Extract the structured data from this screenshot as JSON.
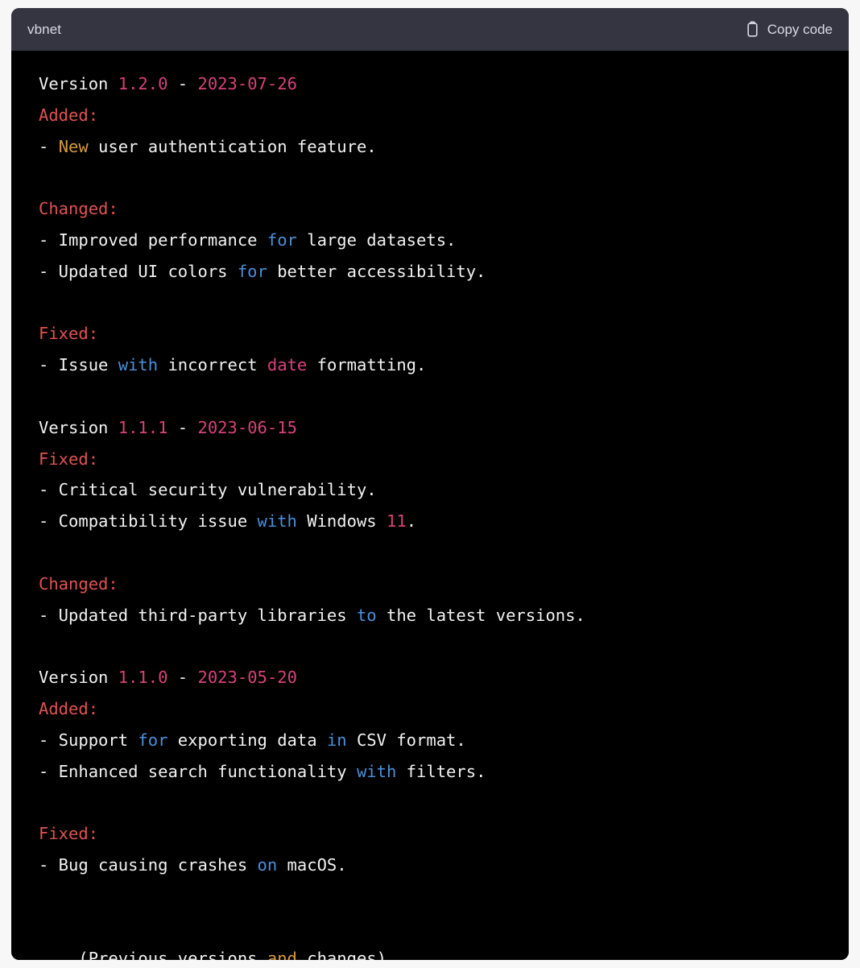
{
  "code_block": {
    "language_label": "vbnet",
    "copy_button": {
      "label": "Copy code",
      "icon": "clipboard-icon"
    },
    "colors": {
      "header_background": "#343541",
      "body_background": "#000000",
      "page_background": "#f7f7f8",
      "default_text": "#f2f2f2",
      "header_text": "#d9d9e3",
      "section_red": "#e05252",
      "number_pink": "#d6427a",
      "keyword_blue": "#4a90d9",
      "literal_orange": "#d79a3a"
    },
    "lines": [
      [
        {
          "t": "Version ",
          "c": "plain"
        },
        {
          "t": "1.2.0",
          "c": "number"
        },
        {
          "t": " - ",
          "c": "plain"
        },
        {
          "t": "2023-07-26",
          "c": "number"
        }
      ],
      [
        {
          "t": "Added:",
          "c": "section"
        }
      ],
      [
        {
          "t": "- ",
          "c": "plain"
        },
        {
          "t": "New",
          "c": "literal"
        },
        {
          "t": " user authentication feature.",
          "c": "plain"
        }
      ],
      [],
      [
        {
          "t": "Changed:",
          "c": "section"
        }
      ],
      [
        {
          "t": "- Improved performance ",
          "c": "plain"
        },
        {
          "t": "for",
          "c": "keyword"
        },
        {
          "t": " large datasets.",
          "c": "plain"
        }
      ],
      [
        {
          "t": "- Updated UI colors ",
          "c": "plain"
        },
        {
          "t": "for",
          "c": "keyword"
        },
        {
          "t": " better accessibility.",
          "c": "plain"
        }
      ],
      [],
      [
        {
          "t": "Fixed:",
          "c": "section"
        }
      ],
      [
        {
          "t": "- Issue ",
          "c": "plain"
        },
        {
          "t": "with",
          "c": "keyword"
        },
        {
          "t": " incorrect ",
          "c": "plain"
        },
        {
          "t": "date",
          "c": "builtin"
        },
        {
          "t": " formatting.",
          "c": "plain"
        }
      ],
      [],
      [
        {
          "t": "Version ",
          "c": "plain"
        },
        {
          "t": "1.1.1",
          "c": "number"
        },
        {
          "t": " - ",
          "c": "plain"
        },
        {
          "t": "2023-06-15",
          "c": "number"
        }
      ],
      [
        {
          "t": "Fixed:",
          "c": "section"
        }
      ],
      [
        {
          "t": "- Critical security vulnerability.",
          "c": "plain"
        }
      ],
      [
        {
          "t": "- Compatibility issue ",
          "c": "plain"
        },
        {
          "t": "with",
          "c": "keyword"
        },
        {
          "t": " Windows ",
          "c": "plain"
        },
        {
          "t": "11",
          "c": "number"
        },
        {
          "t": ".",
          "c": "plain"
        }
      ],
      [],
      [
        {
          "t": "Changed:",
          "c": "section"
        }
      ],
      [
        {
          "t": "- Updated third-party libraries ",
          "c": "plain"
        },
        {
          "t": "to",
          "c": "keyword"
        },
        {
          "t": " the latest versions.",
          "c": "plain"
        }
      ],
      [],
      [
        {
          "t": "Version ",
          "c": "plain"
        },
        {
          "t": "1.1.0",
          "c": "number"
        },
        {
          "t": " - ",
          "c": "plain"
        },
        {
          "t": "2023-05-20",
          "c": "number"
        }
      ],
      [
        {
          "t": "Added:",
          "c": "section"
        }
      ],
      [
        {
          "t": "- Support ",
          "c": "plain"
        },
        {
          "t": "for",
          "c": "keyword"
        },
        {
          "t": " exporting data ",
          "c": "plain"
        },
        {
          "t": "in",
          "c": "keyword"
        },
        {
          "t": " CSV format.",
          "c": "plain"
        }
      ],
      [
        {
          "t": "- Enhanced search functionality ",
          "c": "plain"
        },
        {
          "t": "with",
          "c": "keyword"
        },
        {
          "t": " filters.",
          "c": "plain"
        }
      ],
      [],
      [
        {
          "t": "Fixed:",
          "c": "section"
        }
      ],
      [
        {
          "t": "- Bug causing crashes ",
          "c": "plain"
        },
        {
          "t": "on",
          "c": "keyword"
        },
        {
          "t": " macOS.",
          "c": "plain"
        }
      ],
      [],
      [],
      [
        {
          "t": "... (Previous versions ",
          "c": "plain"
        },
        {
          "t": "and",
          "c": "literal"
        },
        {
          "t": " changes) ...",
          "c": "plain"
        }
      ]
    ]
  }
}
